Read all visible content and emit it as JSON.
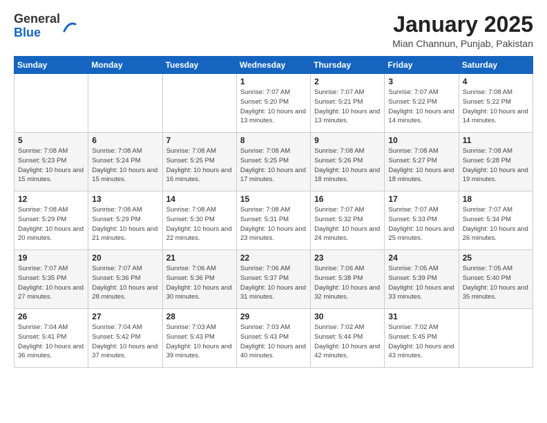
{
  "logo": {
    "general": "General",
    "blue": "Blue"
  },
  "title": "January 2025",
  "subtitle": "Mian Channun, Punjab, Pakistan",
  "days_of_week": [
    "Sunday",
    "Monday",
    "Tuesday",
    "Wednesday",
    "Thursday",
    "Friday",
    "Saturday"
  ],
  "weeks": [
    [
      {
        "day": "",
        "info": ""
      },
      {
        "day": "",
        "info": ""
      },
      {
        "day": "",
        "info": ""
      },
      {
        "day": "1",
        "info": "Sunrise: 7:07 AM\nSunset: 5:20 PM\nDaylight: 10 hours\nand 13 minutes."
      },
      {
        "day": "2",
        "info": "Sunrise: 7:07 AM\nSunset: 5:21 PM\nDaylight: 10 hours\nand 13 minutes."
      },
      {
        "day": "3",
        "info": "Sunrise: 7:07 AM\nSunset: 5:22 PM\nDaylight: 10 hours\nand 14 minutes."
      },
      {
        "day": "4",
        "info": "Sunrise: 7:08 AM\nSunset: 5:22 PM\nDaylight: 10 hours\nand 14 minutes."
      }
    ],
    [
      {
        "day": "5",
        "info": "Sunrise: 7:08 AM\nSunset: 5:23 PM\nDaylight: 10 hours\nand 15 minutes."
      },
      {
        "day": "6",
        "info": "Sunrise: 7:08 AM\nSunset: 5:24 PM\nDaylight: 10 hours\nand 15 minutes."
      },
      {
        "day": "7",
        "info": "Sunrise: 7:08 AM\nSunset: 5:25 PM\nDaylight: 10 hours\nand 16 minutes."
      },
      {
        "day": "8",
        "info": "Sunrise: 7:08 AM\nSunset: 5:25 PM\nDaylight: 10 hours\nand 17 minutes."
      },
      {
        "day": "9",
        "info": "Sunrise: 7:08 AM\nSunset: 5:26 PM\nDaylight: 10 hours\nand 18 minutes."
      },
      {
        "day": "10",
        "info": "Sunrise: 7:08 AM\nSunset: 5:27 PM\nDaylight: 10 hours\nand 18 minutes."
      },
      {
        "day": "11",
        "info": "Sunrise: 7:08 AM\nSunset: 5:28 PM\nDaylight: 10 hours\nand 19 minutes."
      }
    ],
    [
      {
        "day": "12",
        "info": "Sunrise: 7:08 AM\nSunset: 5:29 PM\nDaylight: 10 hours\nand 20 minutes."
      },
      {
        "day": "13",
        "info": "Sunrise: 7:08 AM\nSunset: 5:29 PM\nDaylight: 10 hours\nand 21 minutes."
      },
      {
        "day": "14",
        "info": "Sunrise: 7:08 AM\nSunset: 5:30 PM\nDaylight: 10 hours\nand 22 minutes."
      },
      {
        "day": "15",
        "info": "Sunrise: 7:08 AM\nSunset: 5:31 PM\nDaylight: 10 hours\nand 23 minutes."
      },
      {
        "day": "16",
        "info": "Sunrise: 7:07 AM\nSunset: 5:32 PM\nDaylight: 10 hours\nand 24 minutes."
      },
      {
        "day": "17",
        "info": "Sunrise: 7:07 AM\nSunset: 5:33 PM\nDaylight: 10 hours\nand 25 minutes."
      },
      {
        "day": "18",
        "info": "Sunrise: 7:07 AM\nSunset: 5:34 PM\nDaylight: 10 hours\nand 26 minutes."
      }
    ],
    [
      {
        "day": "19",
        "info": "Sunrise: 7:07 AM\nSunset: 5:35 PM\nDaylight: 10 hours\nand 27 minutes."
      },
      {
        "day": "20",
        "info": "Sunrise: 7:07 AM\nSunset: 5:36 PM\nDaylight: 10 hours\nand 28 minutes."
      },
      {
        "day": "21",
        "info": "Sunrise: 7:06 AM\nSunset: 5:36 PM\nDaylight: 10 hours\nand 30 minutes."
      },
      {
        "day": "22",
        "info": "Sunrise: 7:06 AM\nSunset: 5:37 PM\nDaylight: 10 hours\nand 31 minutes."
      },
      {
        "day": "23",
        "info": "Sunrise: 7:06 AM\nSunset: 5:38 PM\nDaylight: 10 hours\nand 32 minutes."
      },
      {
        "day": "24",
        "info": "Sunrise: 7:05 AM\nSunset: 5:39 PM\nDaylight: 10 hours\nand 33 minutes."
      },
      {
        "day": "25",
        "info": "Sunrise: 7:05 AM\nSunset: 5:40 PM\nDaylight: 10 hours\nand 35 minutes."
      }
    ],
    [
      {
        "day": "26",
        "info": "Sunrise: 7:04 AM\nSunset: 5:41 PM\nDaylight: 10 hours\nand 36 minutes."
      },
      {
        "day": "27",
        "info": "Sunrise: 7:04 AM\nSunset: 5:42 PM\nDaylight: 10 hours\nand 37 minutes."
      },
      {
        "day": "28",
        "info": "Sunrise: 7:03 AM\nSunset: 5:43 PM\nDaylight: 10 hours\nand 39 minutes."
      },
      {
        "day": "29",
        "info": "Sunrise: 7:03 AM\nSunset: 5:43 PM\nDaylight: 10 hours\nand 40 minutes."
      },
      {
        "day": "30",
        "info": "Sunrise: 7:02 AM\nSunset: 5:44 PM\nDaylight: 10 hours\nand 42 minutes."
      },
      {
        "day": "31",
        "info": "Sunrise: 7:02 AM\nSunset: 5:45 PM\nDaylight: 10 hours\nand 43 minutes."
      },
      {
        "day": "",
        "info": ""
      }
    ]
  ]
}
